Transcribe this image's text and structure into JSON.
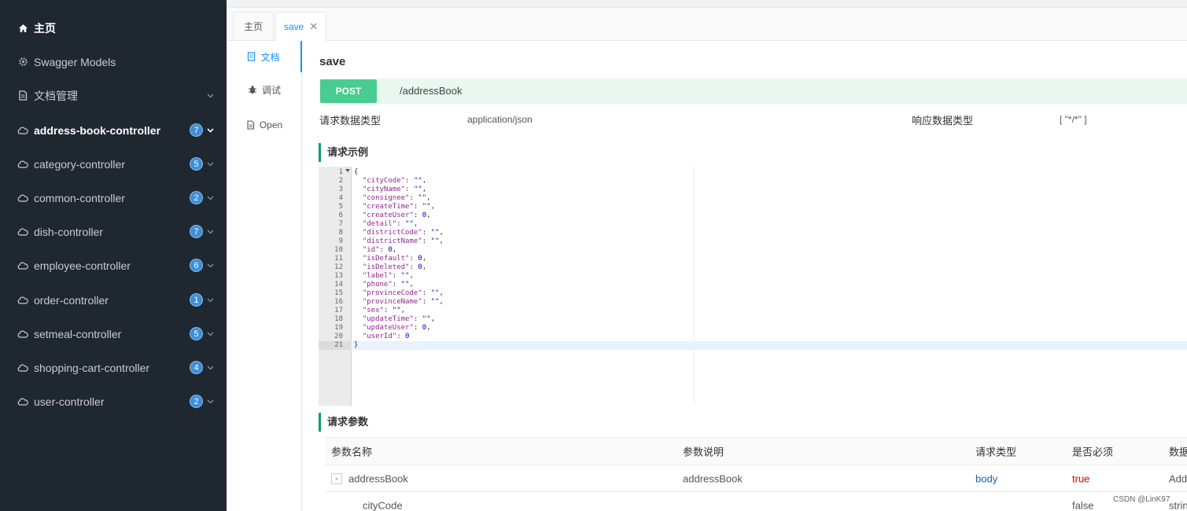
{
  "sidebar": {
    "items": [
      {
        "label": "主页",
        "icon": "home-icon",
        "active": true,
        "badge": "",
        "chevron": false
      },
      {
        "label": "Swagger Models",
        "icon": "gear-icon",
        "active": false,
        "badge": "",
        "chevron": false
      },
      {
        "label": "文档管理",
        "icon": "document-icon",
        "active": false,
        "badge": "",
        "chevron": true
      },
      {
        "label": "address-book-controller",
        "icon": "cloud-icon",
        "active": true,
        "badge": "7",
        "chevron": true
      },
      {
        "label": "category-controller",
        "icon": "cloud-icon",
        "active": false,
        "badge": "5",
        "chevron": true
      },
      {
        "label": "common-controller",
        "icon": "cloud-icon",
        "active": false,
        "badge": "2",
        "chevron": true
      },
      {
        "label": "dish-controller",
        "icon": "cloud-icon",
        "active": false,
        "badge": "7",
        "chevron": true
      },
      {
        "label": "employee-controller",
        "icon": "cloud-icon",
        "active": false,
        "badge": "6",
        "chevron": true
      },
      {
        "label": "order-controller",
        "icon": "cloud-icon",
        "active": false,
        "badge": "1",
        "chevron": true
      },
      {
        "label": "setmeal-controller",
        "icon": "cloud-icon",
        "active": false,
        "badge": "5",
        "chevron": true
      },
      {
        "label": "shopping-cart-controller",
        "icon": "cloud-icon",
        "active": false,
        "badge": "4",
        "chevron": true
      },
      {
        "label": "user-controller",
        "icon": "cloud-icon",
        "active": false,
        "badge": "2",
        "chevron": true
      }
    ]
  },
  "tabs": {
    "home": "主页",
    "current": "save",
    "close": "✕"
  },
  "submenu": {
    "doc": "文档",
    "debug": "调试",
    "open": "Open"
  },
  "operation": {
    "title": "save",
    "method": "POST",
    "path": "/addressBook",
    "request_type_label": "请求数据类型",
    "request_type_value": "application/json",
    "response_type_label": "响应数据类型",
    "response_type_value": "[ \"*/*\" ]"
  },
  "sections": {
    "example": "请求示例",
    "params": "请求参数"
  },
  "code": {
    "lines": [
      "{",
      "  \"cityCode\": \"\",",
      "  \"cityName\": \"\",",
      "  \"consignee\": \"\",",
      "  \"createTime\": \"\",",
      "  \"createUser\": 0,",
      "  \"detail\": \"\",",
      "  \"districtCode\": \"\",",
      "  \"districtName\": \"\",",
      "  \"id\": 0,",
      "  \"isDefault\": 0,",
      "  \"isDeleted\": 0,",
      "  \"label\": \"\",",
      "  \"phone\": \"\",",
      "  \"provinceCode\": \"\",",
      "  \"provinceName\": \"\",",
      "  \"sex\": \"\",",
      "  \"updateTime\": \"\",",
      "  \"updateUser\": 0,",
      "  \"userId\": 0",
      "}"
    ],
    "active_line": 21
  },
  "params_table": {
    "headers": [
      "参数名称",
      "参数说明",
      "请求类型",
      "是否必须",
      "数据"
    ],
    "rows": [
      {
        "expand": "-",
        "name": "addressBook",
        "desc": "addressBook",
        "in": "body",
        "required": "true",
        "type": "Add"
      },
      {
        "expand": "",
        "name": "cityCode",
        "desc": "",
        "in": "",
        "required": "false",
        "type": "strin"
      }
    ]
  },
  "watermark": "CSDN @LinK97",
  "colors": {
    "sidebar_bg": "#1f2730",
    "accent": "#1890ff",
    "post_green": "#49cc90",
    "section_bar": "#0e9a72",
    "badge_blue": "#3d8fd6"
  }
}
